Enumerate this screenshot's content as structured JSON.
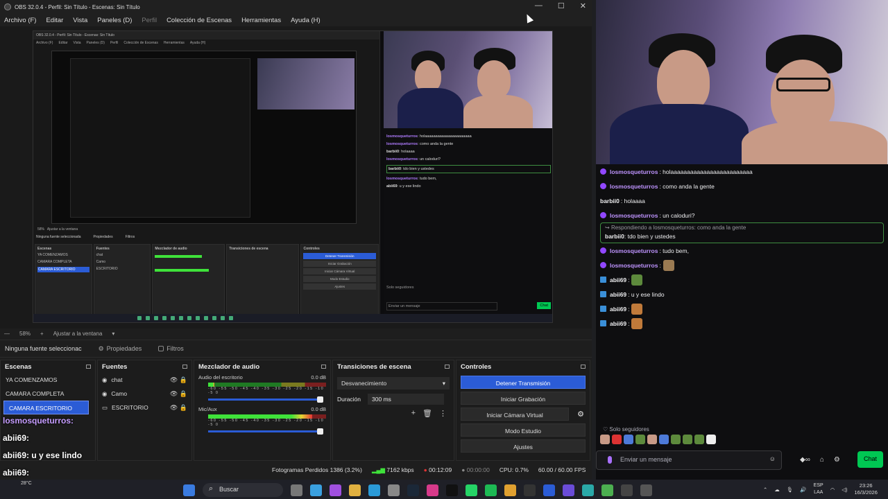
{
  "window": {
    "title": "OBS 32.0.4 - Perfil: Sin Título - Escenas: Sin Título",
    "controls": [
      "—",
      "☐",
      "✕"
    ]
  },
  "menu": {
    "items": [
      "Archivo (F)",
      "Editar",
      "Vista",
      "Paneles (D)"
    ],
    "disabled": "Perfil",
    "items2": [
      "Colección de Escenas",
      "Herramientas",
      "Ayuda (H)"
    ]
  },
  "nested": {
    "title": "OBS 32.0.4 - Perfil: Sin Título - Escenas: Sin Título",
    "menu": [
      "Archivo (F)",
      "Editar",
      "Vista",
      "Paneles (D)",
      "Perfil",
      "Colección de Escenas",
      "Herramientas",
      "Ayuda (H)"
    ],
    "zoom": "58%",
    "zoom_label": "Ajustar a la ventana",
    "no_source": "Ninguna fuente seleccionada",
    "props": "Propiedades",
    "filters": "Filtros",
    "scenes_title": "Escenas",
    "scenes": [
      "YA COMENZAMOS",
      "CAMARA COMPLETA",
      "CAMARA ESCRITORIO"
    ],
    "sources_title": "Fuentes",
    "sources": [
      "chat",
      "Camo",
      "ESCRITORIO"
    ],
    "mixer_title": "Mezclador de audio",
    "transitions_title": "Transiciones de escena",
    "controls_title": "Controles",
    "buttons": [
      "Detener Transmisión",
      "Iniciar Grabación",
      "Iniciar Cámara Virtual",
      "Modo Estudio",
      "Ajustes"
    ],
    "search": "Buscar",
    "chat_lines": [
      {
        "user": "losmosqueturros",
        "text": "holaaaaaaaaaaaaaaaaaaaaaa"
      },
      {
        "user": "losmosqueturros",
        "text": "como anda la gente"
      },
      {
        "user": "barbii0",
        "text": "holaaaa"
      },
      {
        "user": "losmosqueturros",
        "text": "un caloduri?"
      },
      {
        "user": "barbii0",
        "text": "tdo bien y ustedes"
      },
      {
        "user": "losmosqueturros",
        "text": "tudo bem,"
      },
      {
        "user": "abii69",
        "text": "u y ese lindo"
      }
    ],
    "followers": "Solo seguidores",
    "send_placeholder": "Enviar un mensaje",
    "chat_btn": "Chat",
    "status": "Fotogramas Perdidos 1386 (3.2%)"
  },
  "zoombar": {
    "zoom": "58%",
    "fit": "Ajustar a la ventana"
  },
  "sourcebar": {
    "no_source": "Ninguna fuente seleccionac",
    "properties": "Propiedades",
    "filters": "Filtros"
  },
  "scenes": {
    "title": "Escenas",
    "items": [
      "YA COMENZAMOS",
      "CAMARA COMPLETA",
      "CAMARA ESCRITORIO"
    ]
  },
  "sources": {
    "title": "Fuentes",
    "items": [
      "chat",
      "Camo",
      "ESCRITORIO"
    ]
  },
  "mixer": {
    "title": "Mezclador de audio",
    "tracks": [
      {
        "name": "Audio del escritorio",
        "db": "0.0 dB",
        "level": 0.05
      },
      {
        "name": "Mic/Aux",
        "db": "0.0 dB",
        "level": 0.88
      }
    ],
    "scale": "-60 -55 -50 -45 -40 -35 -30 -25 -20 -15 -10 -5 0"
  },
  "transitions": {
    "title": "Transiciones de escena",
    "selected": "Desvanecimiento",
    "duration_label": "Duración",
    "duration": "300 ms"
  },
  "controls": {
    "title": "Controles",
    "stop_stream": "Detener Transmisión",
    "start_recording": "Iniciar Grabación",
    "virtual_cam": "Iniciar Cámara Virtual",
    "studio_mode": "Modo Estudio",
    "settings": "Ajustes"
  },
  "status": {
    "dropped": "Fotogramas Perdidos 1386 (3.2%)",
    "kbps": "7162 kbps",
    "live_time": "00:12:09",
    "rec_time": "00:00:00",
    "cpu": "CPU: 0.7%",
    "fps": "60.00 / 60.00 FPS"
  },
  "overlay_chat": [
    {
      "user": "losmosqueturros:",
      "text": ""
    },
    {
      "user": "abii69:",
      "text": ""
    },
    {
      "user": "abii69:",
      "text": "u y ese lindo"
    },
    {
      "user": "abii69:",
      "text": ""
    },
    {
      "user": "abii69:",
      "text": ""
    }
  ],
  "chat": {
    "messages": [
      {
        "user": "losmosqueturros",
        "text": ": holaaaaaaaaaaaaaaaaaaaaaaaaa",
        "badge": "purple"
      },
      {
        "user": "losmosqueturros",
        "text": ": como anda la gente",
        "badge": "purple"
      },
      {
        "user": "barbii0",
        "text": ": holaaaa",
        "badge": "none"
      },
      {
        "user": "losmosqueturros",
        "text": ": un caloduri?",
        "badge": "purple"
      }
    ],
    "reply": {
      "context": "Respondiendo a losmosqueturros: como anda la gente",
      "user": "barbii0",
      "text": ": tdo bien y ustedes"
    },
    "messages2": [
      {
        "user": "losmosqueturros",
        "text": ": tudo bem,",
        "badge": "purple"
      },
      {
        "user": "losmosqueturros",
        "text": ":",
        "badge": "purple"
      },
      {
        "user": "abii69",
        "text": ":",
        "badge": "arrow"
      },
      {
        "user": "abii69",
        "text": ": u y ese lindo",
        "badge": "arrow"
      },
      {
        "user": "abii69",
        "text": ":",
        "badge": "arrow"
      },
      {
        "user": "abii69",
        "text": ":",
        "badge": "arrow"
      }
    ],
    "followers_only": "Solo seguidores",
    "input_placeholder": "Enviar un mensaje",
    "send_button": "Chat"
  },
  "taskbar": {
    "weather_temp": "28°C",
    "search": "Buscar",
    "lang_top": "ESP",
    "lang_bottom": "LAA",
    "time": "23:26",
    "date": "16/3/2026",
    "badge_count": "29"
  },
  "colors": {
    "accent": "#2b5cd6",
    "chat_purple": "#bf94ff",
    "chat_send": "#00c853",
    "reply_border": "#3e8e41"
  }
}
